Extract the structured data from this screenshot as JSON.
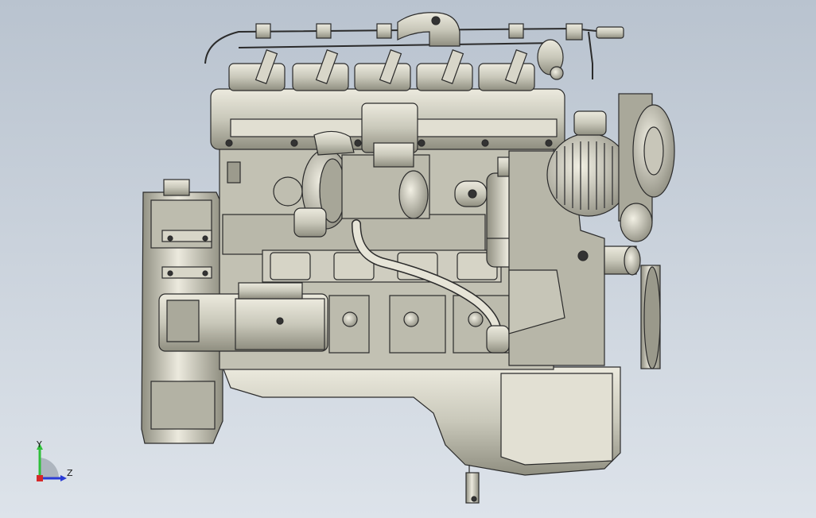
{
  "viewport": {
    "background_top": "#b9c3cf",
    "background_bottom": "#dde3ea"
  },
  "model": {
    "icon": "engine-model",
    "body_color": "#c9c8ba",
    "shade_color": "#8f8e80",
    "highlight_color": "#eceade",
    "line_color": "#2b2b2b"
  },
  "triad": {
    "y_label": "Y",
    "z_label": "Z",
    "y_color": "#2fbf3a",
    "z_color": "#2a3bd6",
    "x_color": "#d62828"
  }
}
